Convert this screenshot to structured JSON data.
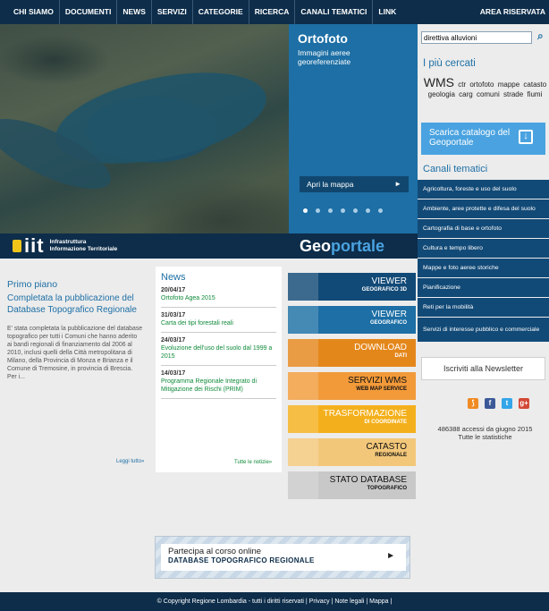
{
  "nav": {
    "items": [
      "CHI SIAMO",
      "DOCUMENTI",
      "NEWS",
      "SERVIZI",
      "CATEGORIE",
      "RICERCA",
      "CANALI TEMATICI",
      "LINK"
    ],
    "area": "AREA RISERVATA"
  },
  "hero": {
    "title": "Ortofoto",
    "subtitle": "Immagini aeree georeferenziate",
    "button": "Apri la mappa",
    "button_arrow": "►",
    "dots": 7,
    "active_dot": 1,
    "iit_logo": "iit",
    "iit_line1": "Infrastruttura",
    "iit_line2": "Informazione Territoriale",
    "geoportale_a": "Geo",
    "geoportale_b": "portale"
  },
  "search": {
    "value": "direttiva alluvioni",
    "icon": "search-icon"
  },
  "cercati": {
    "title": "I più cercati",
    "tags": [
      {
        "text": "WMS",
        "big": true
      },
      {
        "text": "ctr"
      },
      {
        "text": "ortofoto"
      },
      {
        "text": "mappe"
      },
      {
        "text": "catasto"
      },
      {
        "text": "geologia"
      },
      {
        "text": "carg"
      },
      {
        "text": "comuni"
      },
      {
        "text": "strade"
      },
      {
        "text": "fiumi"
      }
    ]
  },
  "catalog": {
    "label": "Scarica catalogo del Geoportale",
    "icon": "download-icon"
  },
  "canali": {
    "title": "Canali tematici",
    "items": [
      "Agricoltura, foreste e uso del suolo",
      "Ambiente, aree protette e difesa del suolo",
      "Cartografia di base e ortofoto",
      "Cultura e tempo libero",
      "Mappe e foto aeree storiche",
      "Pianificazione",
      "Reti per la mobilità",
      "Servizi di interesse pubblico e commerciale"
    ]
  },
  "newsletter": {
    "label": "Iscriviti alla Newsletter"
  },
  "social": [
    {
      "name": "rss-icon",
      "glyph": "⟆",
      "color": "#f08a24"
    },
    {
      "name": "facebook-icon",
      "glyph": "f",
      "color": "#3b5998"
    },
    {
      "name": "twitter-icon",
      "glyph": "t",
      "color": "#33a5e8"
    },
    {
      "name": "googleplus-icon",
      "glyph": "g+",
      "color": "#d34836"
    }
  ],
  "counter": {
    "line1": "486388 accessi da giugno 2015",
    "line2": "Tutte le statistiche"
  },
  "primo": {
    "title": "Primo piano",
    "headline": "Completata la pubblicazione del Database Topografico Regionale",
    "body": "E' stata completata la pubblicazione del database topografico per tutti i Comuni che hanno aderito ai bandi regionali di finanziamento dal 2006 al 2010, inclusi quelli della Città metropolitana di Milano, della Provincia di Monza e Brianza e il Comune di Tremosine, in provincia di Brescia. Per i...",
    "more": "Leggi tutto»"
  },
  "news": {
    "title": "News",
    "items": [
      {
        "date": "20/04/17",
        "text": "Ortofoto Agea 2015"
      },
      {
        "date": "31/03/17",
        "text": "Carta dei tipi forestali reali"
      },
      {
        "date": "24/03/17",
        "text": "Evoluzione dell'uso del suolo dal 1999 a 2015"
      },
      {
        "date": "14/03/17",
        "text": "Programma Regionale Integrato di Mitigazione dei Rischi (PRIM)"
      }
    ],
    "more": "Tutte le notizie»"
  },
  "tiles": [
    {
      "t1": "VIEWER",
      "t2": "GEOGRAFICO 3D",
      "bg": "#124a77",
      "fg": "#ffffff",
      "icon": "viewer3d-icon"
    },
    {
      "t1": "VIEWER",
      "t2": "GEOGRAFICO",
      "bg": "#1d6fa5",
      "fg": "#ffffff",
      "icon": "viewer-icon"
    },
    {
      "t1": "DOWNLOAD",
      "t2": "DATI",
      "bg": "#e4871b",
      "fg": "#ffffff",
      "icon": "download-tile-icon"
    },
    {
      "t1": "SERVIZI WMS",
      "t2": "WEB MAP SERVICE",
      "bg": "#f29a3a",
      "fg": "#111111",
      "icon": "pin-icon"
    },
    {
      "t1": "TRASFORMAZIONE",
      "t2": "DI COORDINATE",
      "bg": "#f4b01c",
      "fg": "#ffffff",
      "icon": "xy-icon"
    },
    {
      "t1": "CATASTO",
      "t2": "REGIONALE",
      "bg": "#f3c77a",
      "fg": "#111111",
      "icon": "cadastre-icon"
    },
    {
      "t1": "STATO DATABASE",
      "t2": "TOPOGRAFICO",
      "bg": "#c8c8c8",
      "fg": "#111111",
      "icon": "database-map-icon"
    }
  ],
  "banner": {
    "line1": "Partecipa al corso online",
    "line2": "DATABASE TOPOGRAFICO REGIONALE",
    "arrow": "►"
  },
  "footer": {
    "copyright": "© Copyright Regione Lombardia - tutti i diritti riservati",
    "links": [
      "Privacy",
      "Note legali",
      "Mappa"
    ]
  }
}
